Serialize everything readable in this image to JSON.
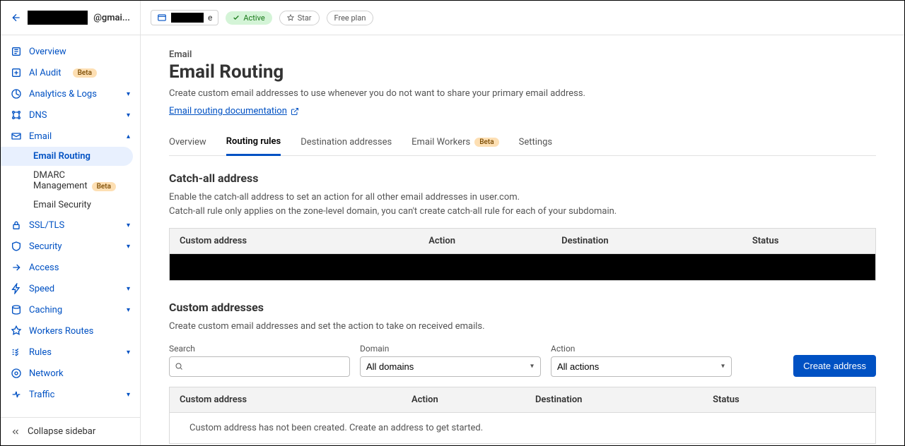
{
  "sidebar": {
    "account_suffix": "@gmai...",
    "items": [
      {
        "label": "Overview",
        "expandable": false
      },
      {
        "label": "AI Audit",
        "expandable": false,
        "badge": "Beta"
      },
      {
        "label": "Analytics & Logs",
        "expandable": true
      },
      {
        "label": "DNS",
        "expandable": true
      },
      {
        "label": "Email",
        "expandable": true,
        "open": true,
        "children": [
          {
            "label": "Email Routing",
            "active": true
          },
          {
            "label": "DMARC Management",
            "badge": "Beta"
          },
          {
            "label": "Email Security"
          }
        ]
      },
      {
        "label": "SSL/TLS",
        "expandable": true
      },
      {
        "label": "Security",
        "expandable": true
      },
      {
        "label": "Access",
        "expandable": false
      },
      {
        "label": "Speed",
        "expandable": true
      },
      {
        "label": "Caching",
        "expandable": true
      },
      {
        "label": "Workers Routes",
        "expandable": false
      },
      {
        "label": "Rules",
        "expandable": true
      },
      {
        "label": "Network",
        "expandable": false
      },
      {
        "label": "Traffic",
        "expandable": true
      }
    ],
    "collapse": "Collapse sidebar"
  },
  "topbar": {
    "domain_suffix": "e",
    "active_pill": "Active",
    "star": "Star",
    "plan": "Free plan"
  },
  "page": {
    "breadcrumb": "Email",
    "title": "Email Routing",
    "subtitle": "Create custom email addresses to use whenever you do not want to share your primary email address.",
    "doclink": "Email routing documentation",
    "tabs": [
      "Overview",
      "Routing rules",
      "Destination addresses",
      "Email Workers",
      "Settings"
    ],
    "workers_badge": "Beta",
    "active_tab": 1
  },
  "catchall": {
    "heading": "Catch-all address",
    "desc1": "Enable the catch-all address to set an action for all other email addresses in user.com.",
    "desc2": "Catch-all rule only applies on the zone-level domain, you can't create catch-all rule for each of your subdomain.",
    "columns": [
      "Custom address",
      "Action",
      "Destination",
      "Status"
    ]
  },
  "custom": {
    "heading": "Custom addresses",
    "desc": "Create custom email addresses and set the action to take on received emails.",
    "search_label": "Search",
    "domain_label": "Domain",
    "domain_value": "All domains",
    "action_label": "Action",
    "action_value": "All actions",
    "create_btn": "Create address",
    "columns": [
      "Custom address",
      "Action",
      "Destination",
      "Status"
    ],
    "empty": "Custom address has not been created. Create an address to get started."
  }
}
